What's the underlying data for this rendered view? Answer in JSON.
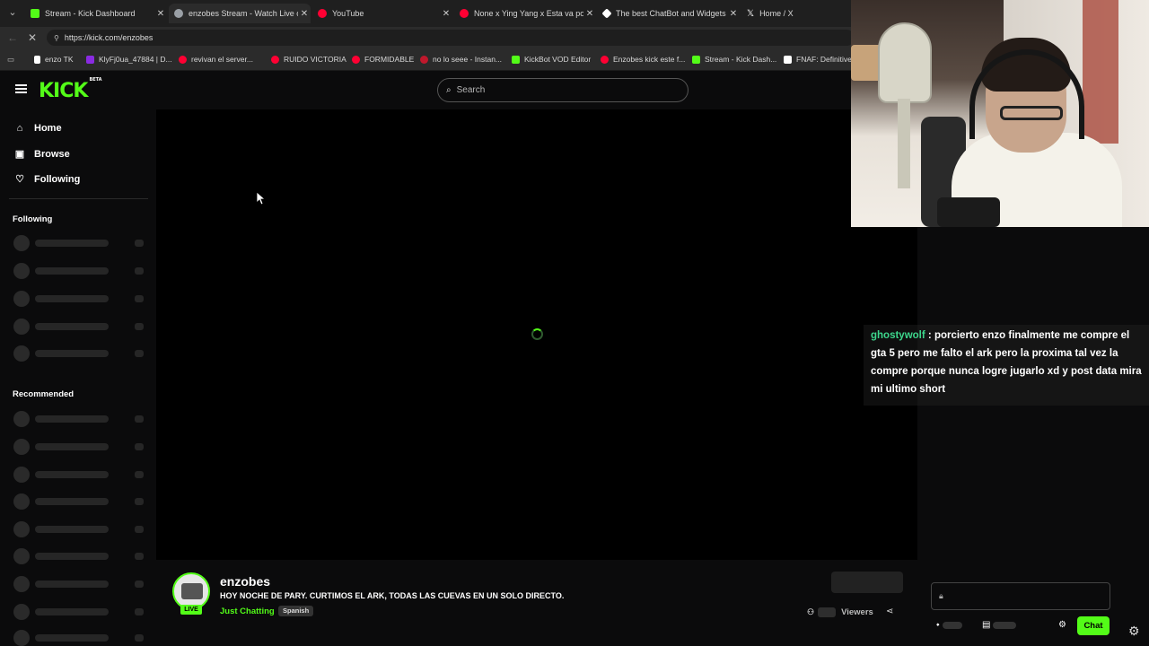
{
  "browser": {
    "tabs": [
      {
        "title": "Stream - Kick Dashboard",
        "favicon_color": "#53fc18",
        "active": false
      },
      {
        "title": "enzobes Stream - Watch Live on K",
        "favicon_color": "#9aa0a6",
        "active": true
      },
      {
        "title": "YouTube",
        "favicon_color": "#ff0033",
        "active": false
      },
      {
        "title": "None x Ying Yang x Esta va porqu",
        "favicon_color": "#ff0033",
        "active": false
      },
      {
        "title": "The best ChatBot and Widgets fo",
        "favicon_color": "#ffffff",
        "active": false
      },
      {
        "title": "Home / X",
        "favicon_color": "#ffffff",
        "active": false
      }
    ],
    "url": "https://kick.com/enzobes",
    "bookmarks": [
      {
        "label": "enzo TK",
        "color": "#ffffff"
      },
      {
        "label": "KlyFj0ua_47884 | D...",
        "color": "#8a2be2"
      },
      {
        "label": "revivan el server...",
        "color": "#ff0033"
      },
      {
        "label": "RUIDO VICTORIA",
        "color": "#ff0033"
      },
      {
        "label": "FORMIDABLE",
        "color": "#ff0033"
      },
      {
        "label": "no lo seee - Instan...",
        "color": "#d62976"
      },
      {
        "label": "KickBot VOD Editor",
        "color": "#53fc18"
      },
      {
        "label": "Enzobes kick este f...",
        "color": "#ff0033"
      },
      {
        "label": "Stream - Kick Dash...",
        "color": "#53fc18"
      },
      {
        "label": "FNAF: Definitive E",
        "color": "#ffffff"
      }
    ]
  },
  "kick": {
    "logo_text": "KICK",
    "logo_badge": "BETA",
    "accent": "#53fc18",
    "search_placeholder": "Search",
    "nav": [
      {
        "label": "Home",
        "icon": "home-icon"
      },
      {
        "label": "Browse",
        "icon": "browse-icon"
      },
      {
        "label": "Following",
        "icon": "heart-icon"
      }
    ],
    "following_heading": "Following",
    "recommended_heading": "Recommended"
  },
  "stream": {
    "username": "enzobes",
    "title": "HOY NOCHE DE PARY. CURTIMOS EL ARK, TODAS LAS CUEVAS EN UN SOLO DIRECTO.",
    "category": "Just Chatting",
    "tag": "Spanish",
    "live_badge": "LIVE",
    "viewers_label": "Viewers"
  },
  "chat": {
    "send_label": "Chat",
    "message": {
      "user": "ghostywolf",
      "text": "porcierto enzo finalmente me compre el gta 5 pero me falto el ark pero la proxima tal vez la compre porque nunca logre jugarlo xd y post data mira mi ultimo short"
    }
  }
}
